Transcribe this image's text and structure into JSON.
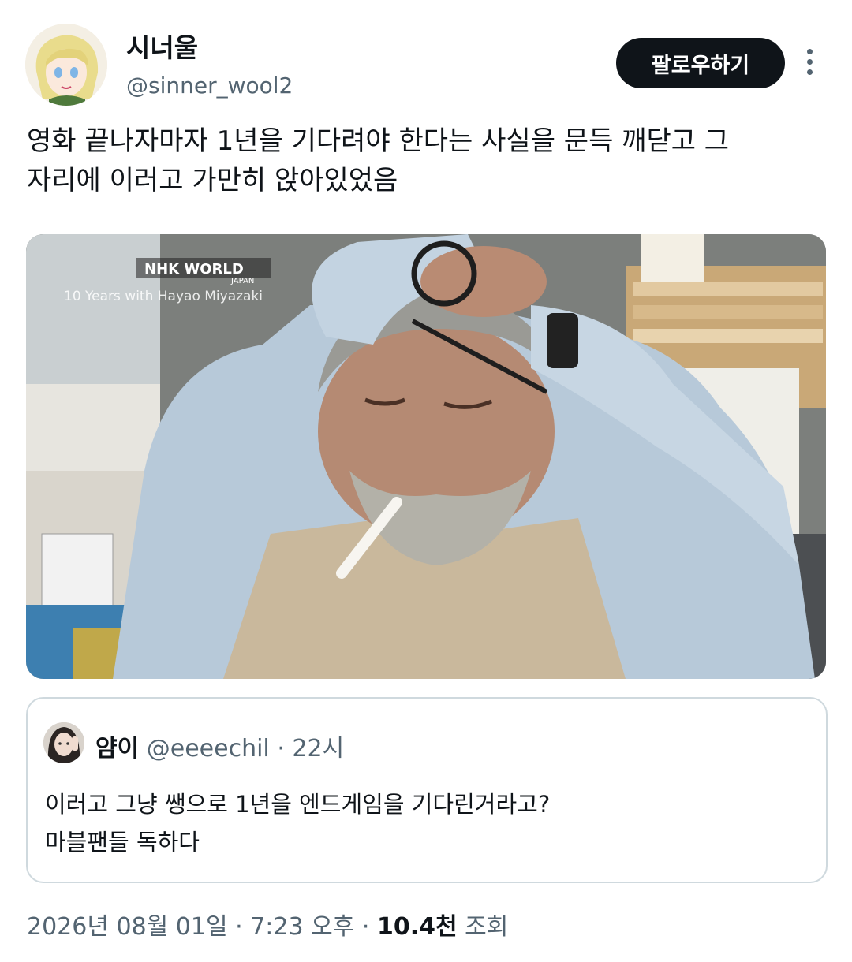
{
  "author": {
    "display_name": "시너울",
    "handle": "@sinner_wool2",
    "avatar_icon": "anime-avatar"
  },
  "actions": {
    "follow_label": "팔로우하기",
    "more_icon": "more-vertical-icon"
  },
  "tweet": {
    "text_line1": "영화 끝나자마자 1년을 기다려야 한다는 사실을 문득 깨닫고 그",
    "text_line2": "자리에 이러고 가만히 앉아있었음"
  },
  "media": {
    "watermark": "NHK WORLD",
    "watermark_sub": "JAPAN",
    "caption": "10 Years with Hayao Miyazaki"
  },
  "quote": {
    "display_name": "얌이",
    "handle": "@eeeechil",
    "separator": "·",
    "time": "22시",
    "text_line1": "이러고 그냥 쌩으로 1년을 엔드게임을 기다린거라고?",
    "text_line2": "마블팬들 독하다"
  },
  "meta": {
    "date": "2026년 08월 01일",
    "sep1": "·",
    "time": "7:23 오후",
    "sep2": "·",
    "views_count": "10.4천",
    "views_label": "조회"
  },
  "colors": {
    "text": "#0f1419",
    "secondary": "#536471",
    "border": "#cfd9de",
    "button_bg": "#0f1419"
  }
}
